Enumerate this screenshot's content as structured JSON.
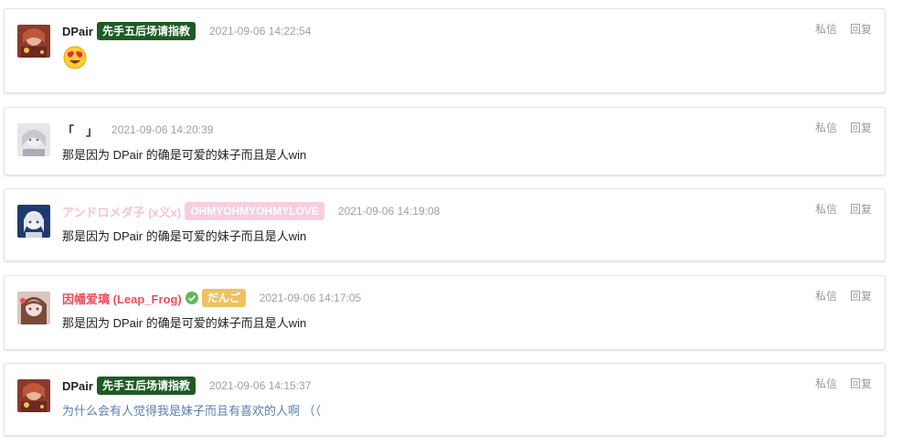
{
  "comments": [
    {
      "user": "DPair",
      "badge": "先手五后场请指教",
      "time": "2021-09-06 14:22:54",
      "content": "",
      "emoji": "heart-eyes-emoji",
      "actions": {
        "dm": "私信",
        "reply": "回复"
      }
    },
    {
      "user": "「　」",
      "badge": "",
      "time": "2021-09-06 14:20:39",
      "content": "那是因为 DPair 的确是可爱的妹子而且是人win",
      "actions": {
        "dm": "私信",
        "reply": "回复"
      }
    },
    {
      "user": "アンドロメダ子 (x义x)",
      "badge": "OHMYOHMYOHMYLOVE",
      "time": "2021-09-06 14:19:08",
      "content": "那是因为 DPair 的确是可爱的妹子而且是人win",
      "actions": {
        "dm": "私信",
        "reply": "回复"
      }
    },
    {
      "user": "因幡爱璃 (Leap_Frog)",
      "badge": "だんご",
      "time": "2021-09-06 14:17:05",
      "content": "那是因为 DPair 的确是可爱的妹子而且是人win",
      "actions": {
        "dm": "私信",
        "reply": "回复"
      }
    },
    {
      "user": "DPair",
      "badge": "先手五后场请指教",
      "time": "2021-09-06 14:15:37",
      "content": "为什么会有人觉得我是妹子而且有喜欢的人啊 （（",
      "actions": {
        "dm": "私信",
        "reply": "回复"
      }
    }
  ],
  "colors": {
    "dpair_badge_bg": "#1e5b24",
    "pink_name": "#f7c1d6",
    "pink_badge_bg": "#f9cde0",
    "red_name": "#e8505b",
    "yellow_badge_bg": "#f0c160",
    "verified_green": "#5cb85c",
    "link_blue": "#5a7fb5"
  }
}
